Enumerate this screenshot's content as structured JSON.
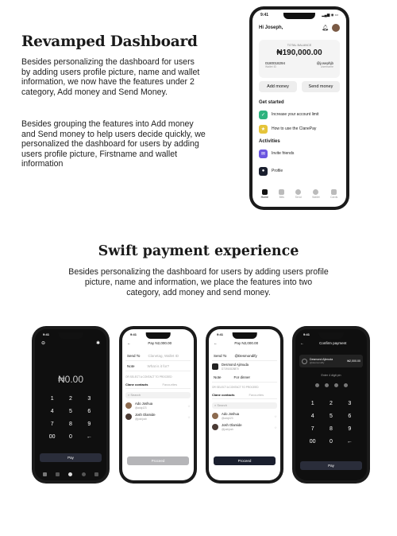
{
  "section1": {
    "title": "Revamped Dashboard",
    "para1": "Besides personalizing the dashboard for users by adding users profile picture, name and wallet information, we now have the features under 2 category, Add money and Send Money.",
    "para2": "Besides grouping the features into Add money and Send money to help users decide quickly, we personalized the dashboard for users by adding users profile picture, Firstname and wallet information"
  },
  "section2": {
    "title": "Swift payment experience",
    "para": "Besides personalizing the dashboard for users by adding users profile picture, name and information, we place the features into two category, add money and send money."
  },
  "dashboard": {
    "time": "9:41",
    "greeting": "Hi Joseph,",
    "balance_label": "TOTAL BALANCE",
    "balance": "₦190,000.00",
    "account_number": "0180018294",
    "bank": "Wallet ID",
    "username": "@josephjb",
    "username_sub": "Username",
    "add_money": "Add money",
    "send_money": "Send money",
    "get_started": "Get started",
    "gs_items": [
      "Increase your account limit",
      "How to use the ClanePay"
    ],
    "activities": "Activities",
    "act_items": [
      "Invite friends",
      "Profile"
    ],
    "tabs": [
      "Home",
      "Bills",
      "Send",
      "Wallet",
      "Cards"
    ]
  },
  "phone_a": {
    "time": "9:41",
    "amount": "₦0.00",
    "keys": [
      "1",
      "2",
      "3",
      "4",
      "5",
      "6",
      "7",
      "8",
      "9",
      "00",
      "0",
      "←"
    ],
    "pay": "Pay"
  },
  "phone_b": {
    "time": "9:41",
    "header": "Pay N2,000.00",
    "send_to": "Send To",
    "send_to_placeholder": "Clanetag, Wallet ID",
    "note": "Note",
    "note_placeholder": "What is it for?",
    "select_label": "OR SELECT A CONTACT TO PROCEED",
    "tab1": "Clane contacts",
    "tab2": "Favourites",
    "search": "Search",
    "contacts": [
      {
        "name": "Ado Joshua",
        "handle": "@adoj423"
      },
      {
        "name": "Josh Olamide",
        "handle": "@joshjosh"
      }
    ],
    "proceed": "Proceed"
  },
  "phone_c": {
    "time": "9:41",
    "header": "Pay N2,000.00",
    "send_to": "Send To",
    "send_to_value": "@Desmondify",
    "recipient_name": "Desmond Ajimuda",
    "recipient_handle": "D73910828870",
    "note": "Note",
    "note_value": "For dinner",
    "select_label": "OR SELECT A CONTACT TO PROCEED",
    "tab1": "Clane contacts",
    "tab2": "Favourites",
    "search": "Search",
    "contacts": [
      {
        "name": "Ado Joshua",
        "handle": "@adoj423"
      },
      {
        "name": "Josh Olamide",
        "handle": "@joshjosh"
      }
    ],
    "proceed": "Proceed"
  },
  "phone_d": {
    "time": "9:41",
    "header": "Confirm payment",
    "recipient_name": "Desmond Ajimuda",
    "recipient_handle": "@desmondify",
    "amount": "₦2,000.00",
    "pin_label": "Enter 4 digit pin",
    "keys": [
      "1",
      "2",
      "3",
      "4",
      "5",
      "6",
      "7",
      "8",
      "9",
      "00",
      "0",
      "←"
    ],
    "pay": "Pay"
  },
  "colors": {
    "accent": "#1a1f2e",
    "dark_bg": "#0f0f0f",
    "green": "#2fb37f",
    "yellow": "#e5c43a",
    "purple": "#6b56e0"
  }
}
